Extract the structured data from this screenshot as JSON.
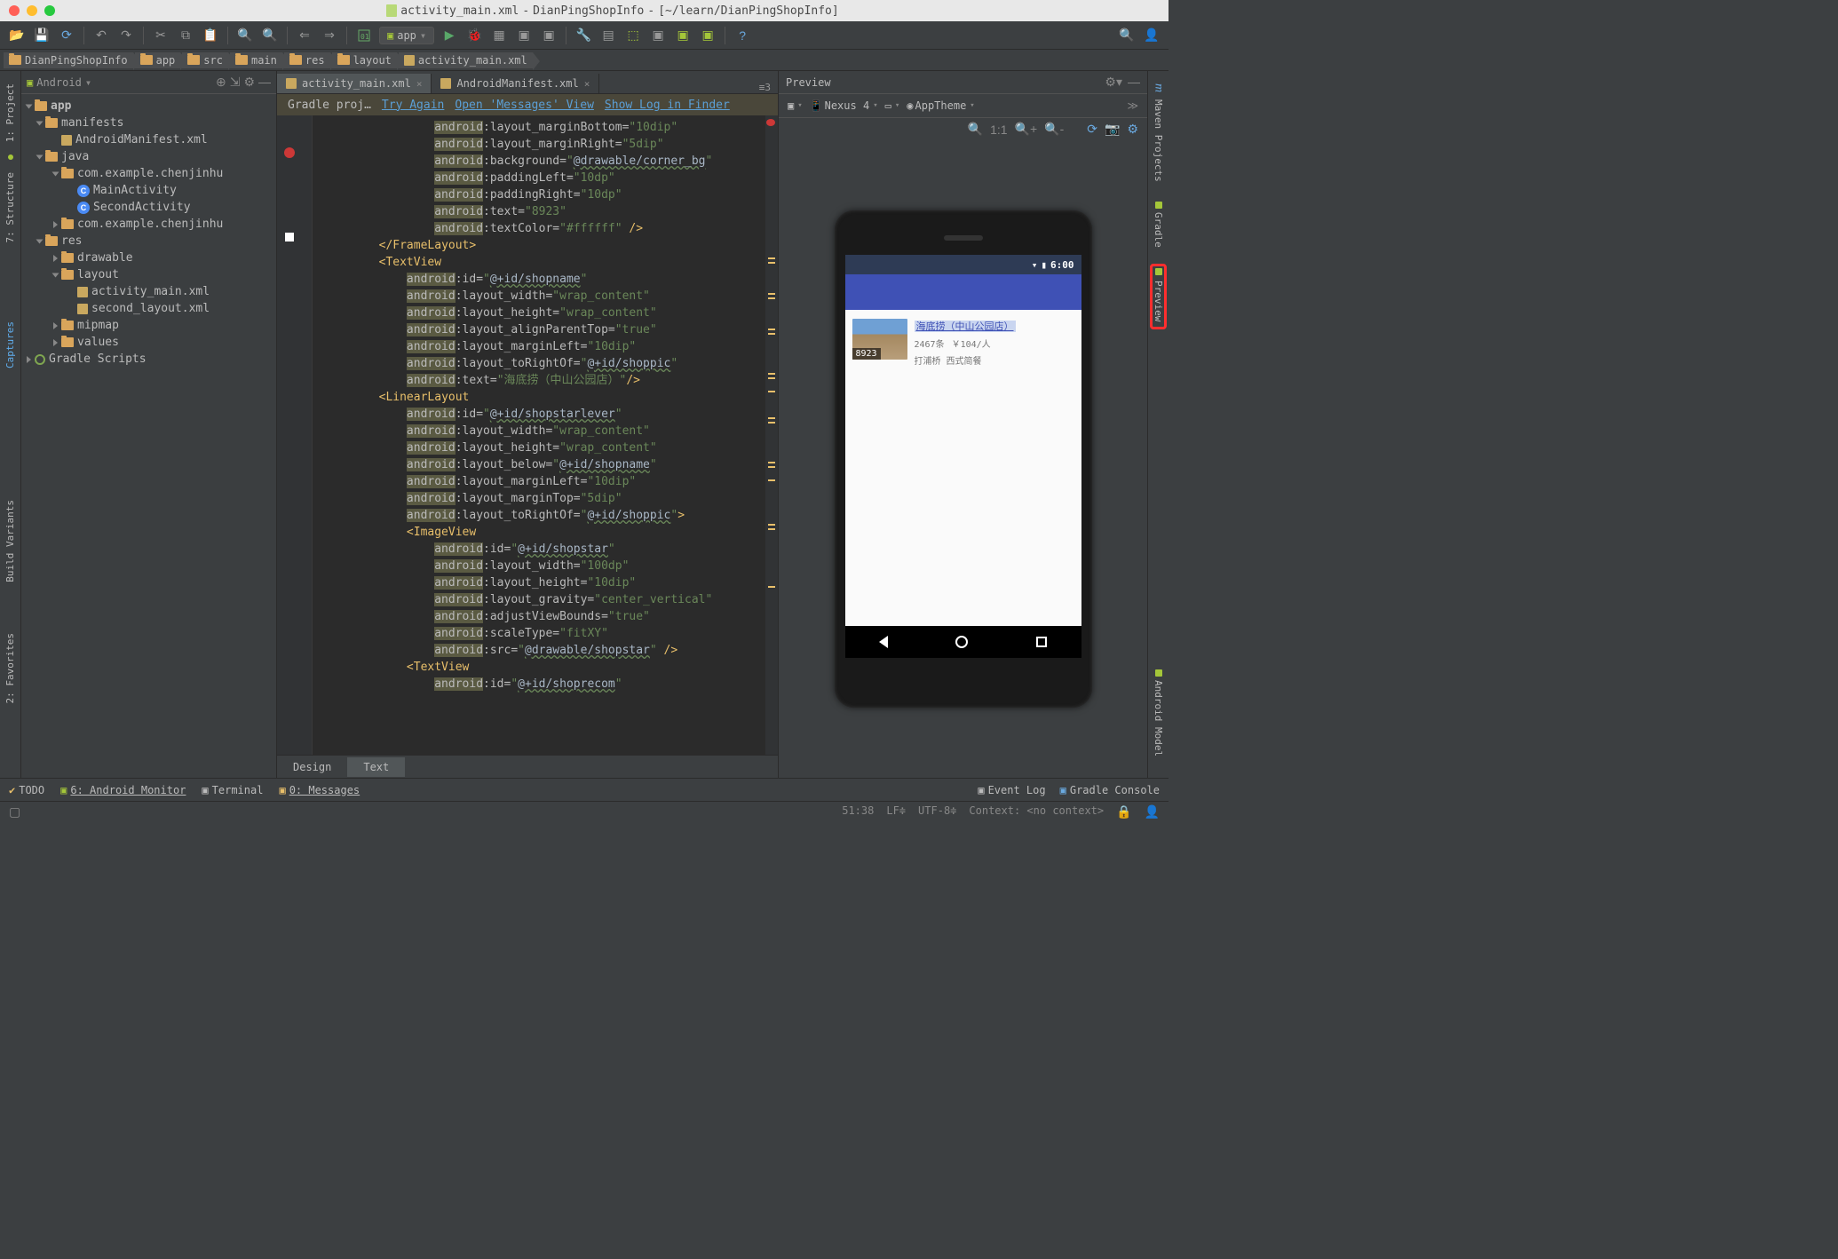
{
  "window": {
    "title_file": "activity_main.xml",
    "title_proj": "DianPingShopInfo",
    "title_path": "[~/learn/DianPingShopInfo]"
  },
  "run_config": {
    "label": "app"
  },
  "breadcrumbs": [
    "DianPingShopInfo",
    "app",
    "src",
    "main",
    "res",
    "layout",
    "activity_main.xml"
  ],
  "project": {
    "view_label": "Android",
    "nodes": [
      {
        "depth": 0,
        "arrow": "down",
        "icon": "folder",
        "label": "app",
        "bold": true
      },
      {
        "depth": 1,
        "arrow": "down",
        "icon": "folder",
        "label": "manifests"
      },
      {
        "depth": 2,
        "arrow": "none",
        "icon": "xml",
        "label": "AndroidManifest.xml"
      },
      {
        "depth": 1,
        "arrow": "down",
        "icon": "folder",
        "label": "java"
      },
      {
        "depth": 2,
        "arrow": "down",
        "icon": "pkg",
        "label": "com.example.chenjinhu"
      },
      {
        "depth": 3,
        "arrow": "none",
        "icon": "class",
        "label": "MainActivity"
      },
      {
        "depth": 3,
        "arrow": "none",
        "icon": "class",
        "label": "SecondActivity"
      },
      {
        "depth": 2,
        "arrow": "right",
        "icon": "pkg",
        "label": "com.example.chenjinhu"
      },
      {
        "depth": 1,
        "arrow": "down",
        "icon": "folder",
        "label": "res"
      },
      {
        "depth": 2,
        "arrow": "right",
        "icon": "folder",
        "label": "drawable"
      },
      {
        "depth": 2,
        "arrow": "down",
        "icon": "folder",
        "label": "layout"
      },
      {
        "depth": 3,
        "arrow": "none",
        "icon": "xml",
        "label": "activity_main.xml"
      },
      {
        "depth": 3,
        "arrow": "none",
        "icon": "xml",
        "label": "second_layout.xml"
      },
      {
        "depth": 2,
        "arrow": "right",
        "icon": "folder",
        "label": "mipmap"
      },
      {
        "depth": 2,
        "arrow": "right",
        "icon": "folder",
        "label": "values"
      },
      {
        "depth": 0,
        "arrow": "right",
        "icon": "gradle",
        "label": "Gradle Scripts"
      }
    ]
  },
  "editor_tabs": {
    "items": [
      {
        "label": "activity_main.xml",
        "active": true
      },
      {
        "label": "AndroidManifest.xml",
        "active": false
      }
    ],
    "info": "≡3"
  },
  "gradle_banner": {
    "prefix": "Gradle proj…",
    "try_again": "Try Again",
    "open_messages": "Open 'Messages' View",
    "show_log": "Show Log in Finder"
  },
  "code": {
    "lines": [
      "                <attr-ns>android</attr-ns><colon>:</colon><attr-nm>layout_marginBottom=</attr-nm><val>\"10dip\"</val>",
      "                <attr-ns>android</attr-ns><colon>:</colon><attr-nm>layout_marginRight=</attr-nm><val>\"5dip\"</val>",
      "                <attr-ns>android</attr-ns><colon>:</colon><attr-nm>background=</attr-nm><val>\"</val><val-ref>@drawable/corner_bg</val-ref><val>\"</val>",
      "                <attr-ns>android</attr-ns><colon>:</colon><attr-nm>paddingLeft=</attr-nm><val>\"10dp\"</val>",
      "                <attr-ns>android</attr-ns><colon>:</colon><attr-nm>paddingRight=</attr-nm><val>\"10dp\"</val>",
      "                <attr-ns>android</attr-ns><colon>:</colon><attr-nm>text=</attr-nm><val>\"8923\"</val>",
      "                <attr-ns>android</attr-ns><colon>:</colon><attr-nm>textColor=</attr-nm><val>\"#ffffff\"</val> <tag>/&gt;</tag>",
      "        <tag>&lt;/FrameLayout&gt;</tag>",
      "        <tag>&lt;TextView</tag>",
      "            <attr-ns>android</attr-ns><colon>:</colon><attr-nm>id=</attr-nm><val>\"</val><val-ref>@+id/shopname</val-ref><val>\"</val>",
      "            <attr-ns>android</attr-ns><colon>:</colon><attr-nm>layout_width=</attr-nm><val>\"wrap_content\"</val>",
      "            <attr-ns>android</attr-ns><colon>:</colon><attr-nm>layout_height=</attr-nm><val>\"wrap_content\"</val>",
      "            <attr-ns>android</attr-ns><colon>:</colon><attr-nm>layout_alignParentTop=</attr-nm><val>\"true\"</val>",
      "            <attr-ns>android</attr-ns><colon>:</colon><attr-nm>layout_marginLeft=</attr-nm><val>\"10dip\"</val>",
      "            <attr-ns>android</attr-ns><colon>:</colon><attr-nm>layout_toRightOf=</attr-nm><val>\"</val><val-ref>@+id/shoppic</val-ref><val>\"</val>",
      "            <attr-ns>android</attr-ns><colon>:</colon><attr-nm>text=</attr-nm><val>\"海底捞（中山公园店）\"</val><tag>/&gt;</tag>",
      "        <tag>&lt;LinearLayout</tag>",
      "            <attr-ns>android</attr-ns><colon>:</colon><attr-nm>id=</attr-nm><val>\"</val><val-ref>@+id/shopstarlever</val-ref><val>\"</val>",
      "            <attr-ns>android</attr-ns><colon>:</colon><attr-nm>layout_width=</attr-nm><val>\"wrap_content\"</val>",
      "            <attr-ns>android</attr-ns><colon>:</colon><attr-nm>layout_height=</attr-nm><val>\"wrap_content\"</val>",
      "            <attr-ns>android</attr-ns><colon>:</colon><attr-nm>layout_below=</attr-nm><val>\"</val><val-ref>@+id/shopname</val-ref><val>\"</val>",
      "            <attr-ns>android</attr-ns><colon>:</colon><attr-nm>layout_marginLeft=</attr-nm><val>\"10dip\"</val>",
      "            <attr-ns>android</attr-ns><colon>:</colon><attr-nm>layout_marginTop=</attr-nm><val>\"5dip\"</val>",
      "            <attr-ns>android</attr-ns><colon>:</colon><attr-nm>layout_toRightOf=</attr-nm><val>\"</val><val-ref>@+id/shoppic</val-ref><val>\"</val><tag>&gt;</tag>",
      "            <tag>&lt;ImageView</tag>",
      "                <attr-ns>android</attr-ns><colon>:</colon><attr-nm>id=</attr-nm><val>\"</val><val-ref>@+id/shopstar</val-ref><val>\"</val>",
      "                <attr-ns>android</attr-ns><colon>:</colon><attr-nm>layout_width=</attr-nm><val>\"100dp\"</val>",
      "                <attr-ns>android</attr-ns><colon>:</colon><attr-nm>layout_height=</attr-nm><val>\"10dip\"</val>",
      "                <attr-ns>android</attr-ns><colon>:</colon><attr-nm>layout_gravity=</attr-nm><val>\"center_vertical\"</val>",
      "                <attr-ns>android</attr-ns><colon>:</colon><attr-nm>adjustViewBounds=</attr-nm><val>\"true\"</val>",
      "                <attr-ns>android</attr-ns><colon>:</colon><attr-nm>scaleType=</attr-nm><val>\"fitXY\"</val>",
      "                <attr-ns>android</attr-ns><colon>:</colon><attr-nm>src=</attr-nm><val>\"</val><val-ref>@drawable/shopstar</val-ref><val>\"</val> <tag>/&gt;</tag>",
      "            <tag>&lt;TextView</tag>",
      "                <attr-ns>android</attr-ns><colon>:</colon><attr-nm>id=</attr-nm><val>\"</val><val-ref>@+id/shoprecom</val-ref><val>\"</val>"
    ]
  },
  "design_tabs": {
    "design": "Design",
    "text": "Text"
  },
  "preview": {
    "title": "Preview",
    "device": "Nexus 4",
    "theme": "AppTheme",
    "clock": "6:00",
    "shop": {
      "badge": "8923",
      "name": "海底捞（中山公园店）",
      "count": "2467条",
      "price": "￥104/人",
      "desc": "打浦桥  西式简餐"
    }
  },
  "bottom": {
    "todo": "TODO",
    "monitor": "6: Android Monitor",
    "terminal": "Terminal",
    "messages": "0: Messages",
    "eventlog": "Event Log",
    "gradle_console": "Gradle Console"
  },
  "status": {
    "pos": "51:38",
    "le": "LF≑",
    "enc": "UTF-8≑",
    "context": "Context: <no context>"
  },
  "rails": {
    "left": [
      "1: Project",
      "7: Structure",
      "Captures",
      "Build Variants",
      "2: Favorites"
    ],
    "right": [
      "Maven Projects",
      "Gradle",
      "Preview",
      "Android Model"
    ]
  }
}
